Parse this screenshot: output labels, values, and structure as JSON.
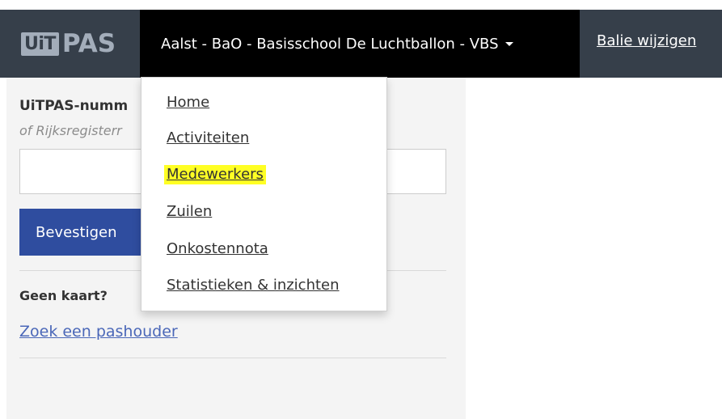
{
  "navbar": {
    "logo_left": "UiT",
    "logo_right": "PAS",
    "balie": "Aalst - BaO - Basisschool De Luchtballon - VBS",
    "change_link": "Balie wijzigen"
  },
  "form": {
    "pas_label": "UiTPAS-numm",
    "pas_hint": "of Rijksregisterr",
    "pas_input_value": "",
    "confirm_label": "Bevestigen",
    "no_card_label": "Geen kaart?",
    "search_link": "Zoek een pashouder"
  },
  "dropdown": {
    "items": [
      {
        "label": "Home"
      },
      {
        "label": "Activiteiten"
      },
      {
        "label": "Medewerkers",
        "highlighted": true
      },
      {
        "label": "Zuilen"
      },
      {
        "label": "Onkostennota"
      },
      {
        "label": "Statistieken & inzichten"
      }
    ]
  },
  "colors": {
    "navbar": "#363f4a",
    "balie_bg": "#000000",
    "button": "#2f4d9f",
    "link": "#4a67b8",
    "highlight": "#ffff24"
  }
}
